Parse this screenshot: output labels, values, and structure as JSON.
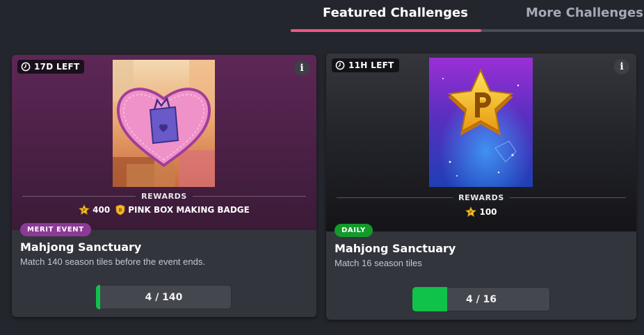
{
  "tabs": [
    {
      "label": "Featured Challenges",
      "active": true
    },
    {
      "label": "More Challenges",
      "active": false
    }
  ],
  "colors": {
    "background": "#24262d",
    "tab_indicator": "#f0557f",
    "merit_badge": "#8c3a96",
    "daily_badge": "#139a2a",
    "progress_fill": "#10c24a"
  },
  "challenges": [
    {
      "time_left": "17D LEFT",
      "info_icon": "info-icon",
      "art_icon": "pink-heart-box-badge",
      "rewards_label": "REWARDS",
      "rewards": [
        {
          "icon": "star-points-icon",
          "text": "400"
        },
        {
          "icon": "badge-shield-icon",
          "text": "PINK BOX MAKING BADGE"
        }
      ],
      "type_badge": "MERIT EVENT",
      "title": "Mahjong Sanctuary",
      "description": "Match 140 season tiles before the event ends.",
      "progress": {
        "current": 4,
        "total": 140,
        "text": "4 / 140"
      }
    },
    {
      "time_left": "11H LEFT",
      "info_icon": "info-icon",
      "art_icon": "gold-star-p",
      "rewards_label": "REWARDS",
      "rewards": [
        {
          "icon": "star-points-icon",
          "text": "100"
        }
      ],
      "type_badge": "DAILY",
      "title": "Mahjong Sanctuary",
      "description": "Match 16 season tiles",
      "progress": {
        "current": 4,
        "total": 16,
        "text": "4 / 16"
      }
    }
  ]
}
